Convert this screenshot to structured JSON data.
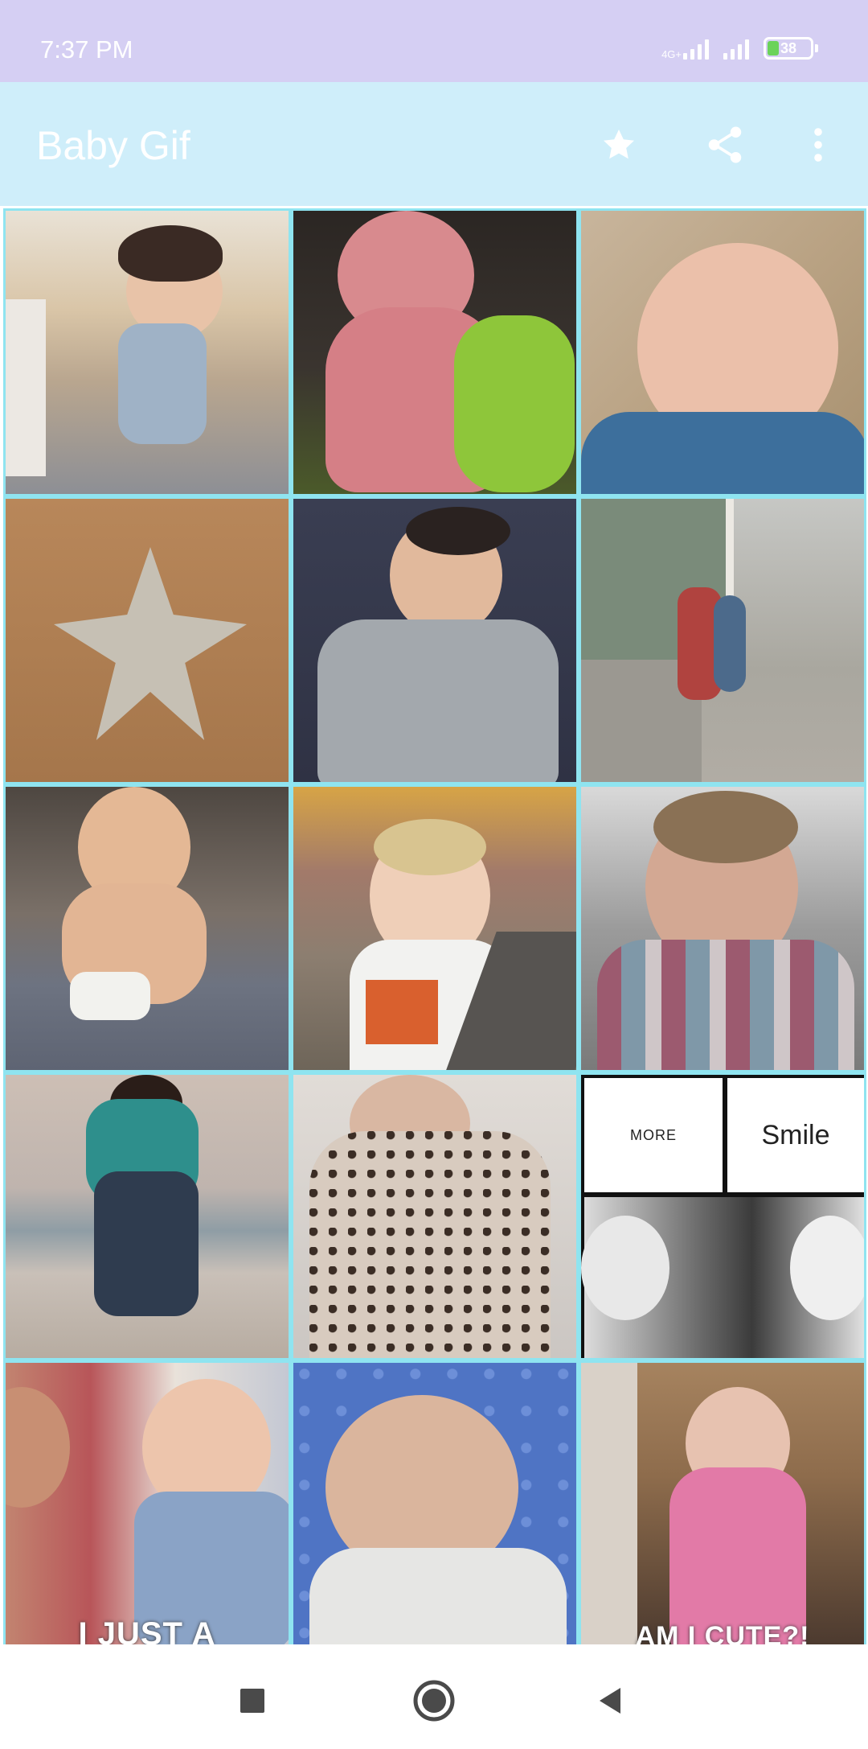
{
  "status_bar": {
    "time": "7:37 PM",
    "network_label": "4G+",
    "battery_level": "38"
  },
  "app_bar": {
    "title": "Baby Gif",
    "actions": [
      "star-icon",
      "share-icon",
      "more-vert-icon"
    ]
  },
  "gallery": {
    "overlay_texts": {
      "cell_10_logo_left": "MORE",
      "cell_10_logo_right": "Smile",
      "cell_12": "I JUST A",
      "cell_14": "AM I CUTE?!"
    }
  },
  "colors": {
    "status_bar": "#d5cff3",
    "app_bar": "#cfeefa",
    "grid_border": "#8fe4f0"
  },
  "nav_bar": {
    "buttons": [
      "recents-button",
      "home-button",
      "back-button"
    ]
  }
}
